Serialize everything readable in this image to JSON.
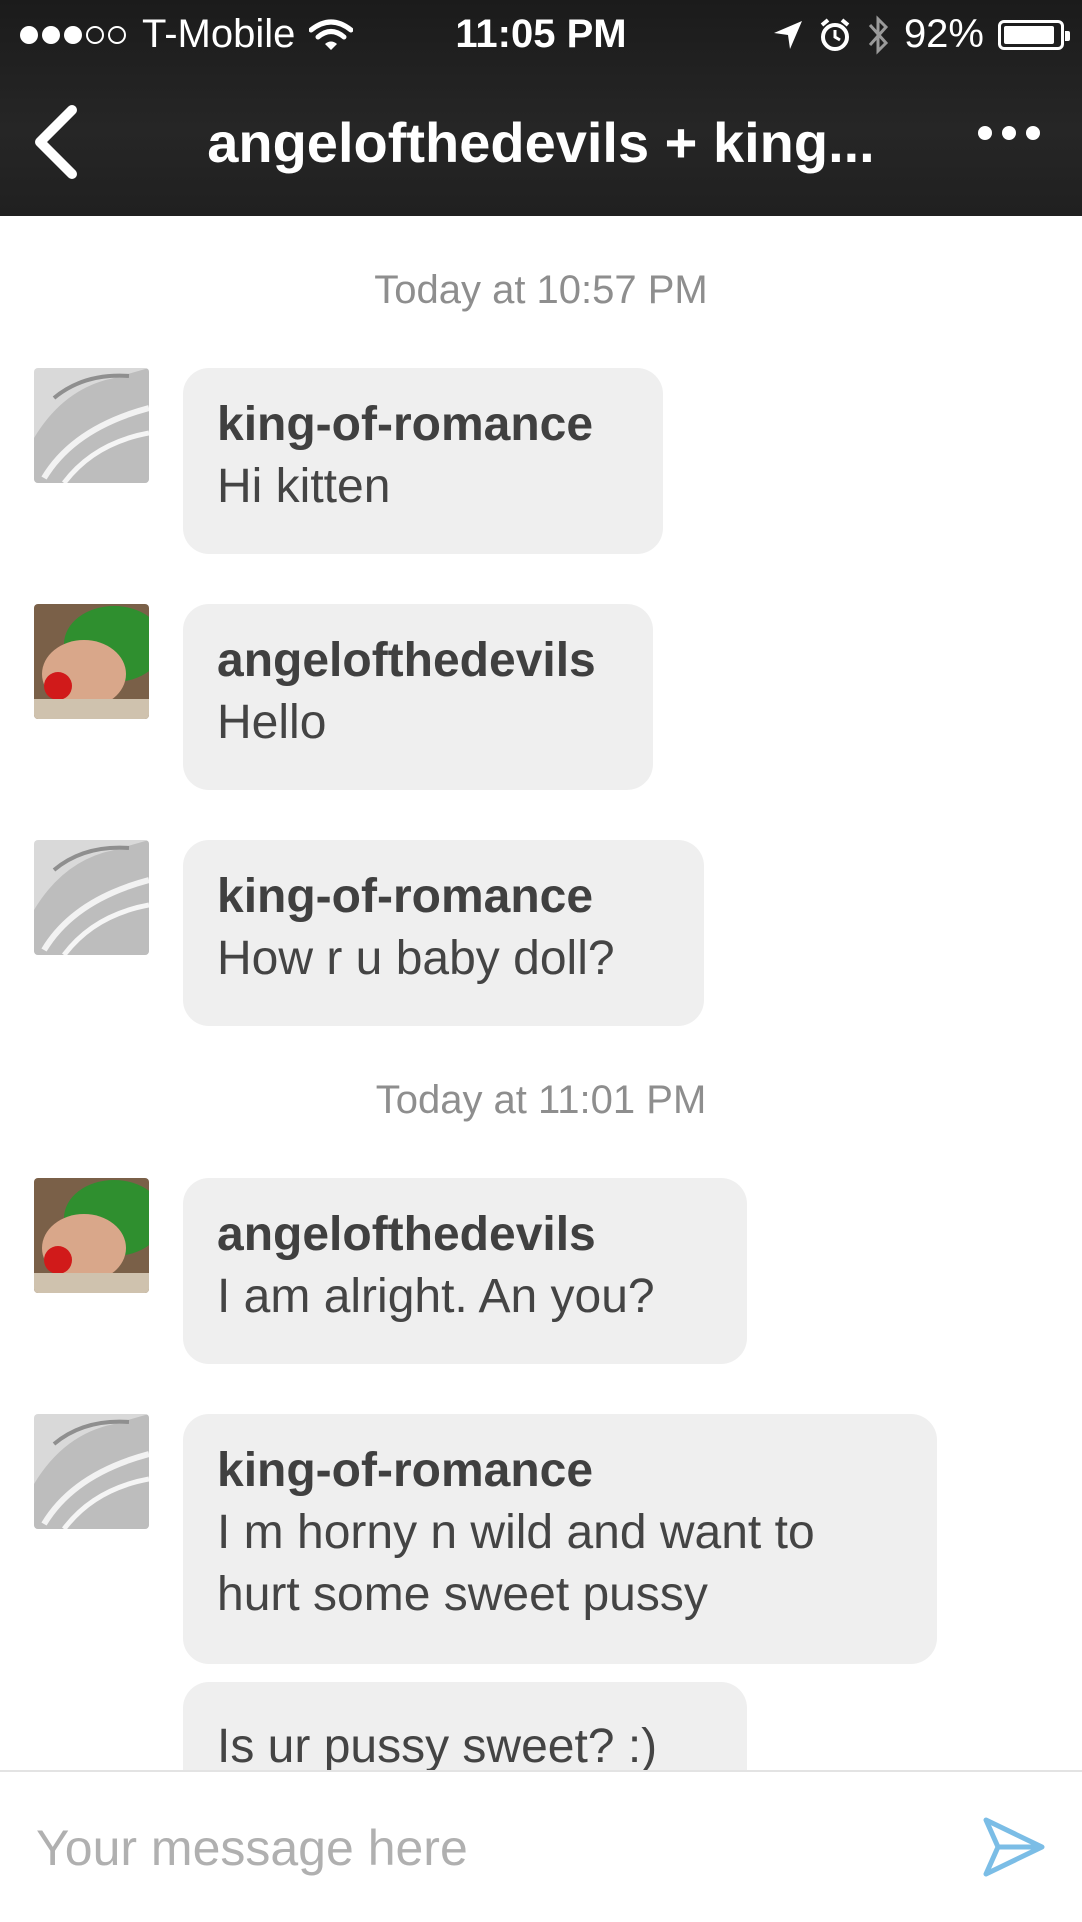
{
  "status_bar": {
    "carrier": "T-Mobile",
    "time": "11:05 PM",
    "battery": "92%",
    "battery_level": 0.92,
    "icons": [
      "signal-dots-icon",
      "wifi-icon",
      "location-arrow-icon",
      "alarm-icon",
      "bluetooth-icon",
      "battery-icon"
    ]
  },
  "header": {
    "title": "angelofthedevils + king...",
    "back_icon": "chevron-left-icon",
    "more_icon": "more-dots-icon"
  },
  "conversation": {
    "timestamps": [
      "Today at 10:57 PM",
      "Today at 11:01 PM"
    ],
    "messages": [
      {
        "sender": "king-of-romance",
        "text": "Hi kitten"
      },
      {
        "sender": "angelofthedevils",
        "text": "Hello"
      },
      {
        "sender": "king-of-romance",
        "text": "How r u baby doll?"
      },
      {
        "sender": "angelofthedevils",
        "text": "I am alright. An you?"
      },
      {
        "sender": "king-of-romance",
        "text": "I m horny n wild and want to hurt some sweet pussy"
      },
      {
        "sender": "",
        "text": "Is ur pussy sweet? :)"
      }
    ]
  },
  "composer": {
    "placeholder": "Your message here",
    "send_icon": "send-icon"
  },
  "colors": {
    "header_bg": "#222222",
    "bubble_bg": "#efefef",
    "timestamp": "#8e8e8e",
    "send_accent": "#7bbde6"
  }
}
